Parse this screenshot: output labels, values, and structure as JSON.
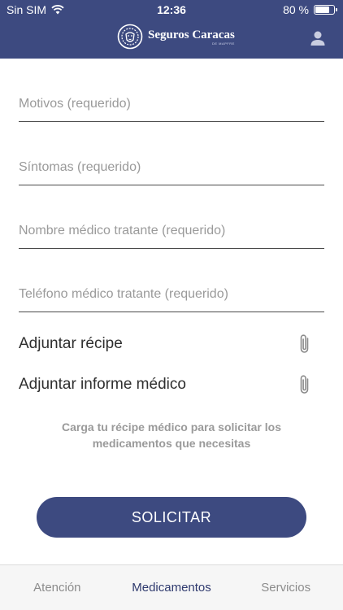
{
  "status_bar": {
    "carrier": "Sin SIM",
    "time": "12:36",
    "battery_percent": "80 %",
    "battery_level": 0.8
  },
  "app_bar": {
    "brand_name": "Seguros Caracas",
    "brand_sub": "DE MAPFRE",
    "logo_icon": "lion-logo-icon",
    "profile_icon": "user-icon"
  },
  "form": {
    "fields": [
      {
        "placeholder": "Motivos (requerido)",
        "value": ""
      },
      {
        "placeholder": "Síntomas (requerido)",
        "value": ""
      },
      {
        "placeholder": "Nombre médico tratante (requerido)",
        "value": ""
      },
      {
        "placeholder": "Teléfono médico tratante (requerido)",
        "value": ""
      }
    ],
    "attachments": [
      {
        "label": "Adjuntar récipe",
        "icon": "paperclip-icon"
      },
      {
        "label": "Adjuntar informe médico",
        "icon": "paperclip-icon"
      }
    ],
    "helper_line1": "Carga tu récipe médico para solicitar los",
    "helper_line2": "medicamentos que necesitas",
    "submit_label": "SOLICITAR"
  },
  "tabs": [
    {
      "label": "Atención",
      "active": false
    },
    {
      "label": "Medicamentos",
      "active": true
    },
    {
      "label": "Servicios",
      "active": false
    }
  ],
  "colors": {
    "brand": "#3d4a80",
    "tab_active": "#2f3a6e",
    "placeholder": "#9a9a9a"
  }
}
